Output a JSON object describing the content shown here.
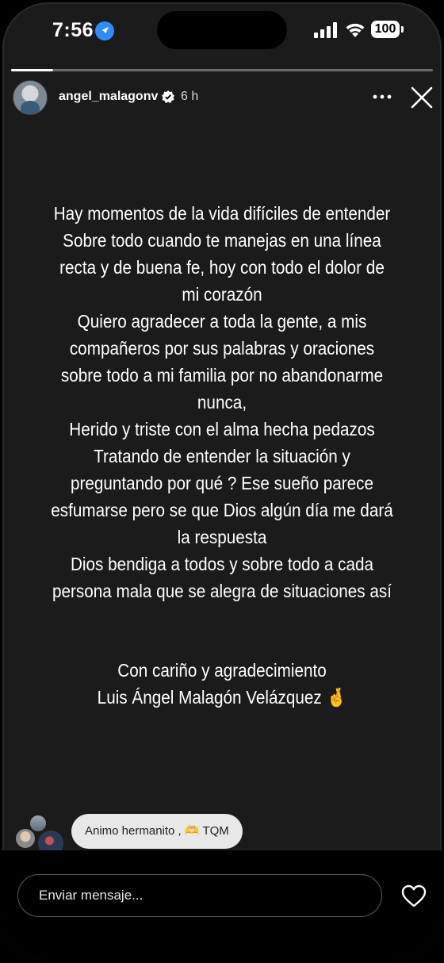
{
  "status_bar": {
    "time": "7:56",
    "battery": "100"
  },
  "story": {
    "progress_fraction": 0.1,
    "username": "angel_malagonv",
    "time_ago": "6 h",
    "text_lines": [
      "Hay momentos de la vida difíciles de entender",
      "Sobre todo cuando te manejas en una línea",
      "recta y de buena fe, hoy con todo el dolor de",
      "mi corazón",
      "Quiero agradecer a toda la gente, a mis",
      "compañeros por sus palabras y oraciones",
      "sobre todo a mi familia por no abandonarme",
      "nunca,",
      "Herido y triste con el alma hecha pedazos",
      "Tratando de entender la situación y",
      "preguntando por qué ? Ese sueño parece",
      "esfumarse pero se que Dios algún día me dará",
      "la respuesta",
      "Dios bendiga a todos y sobre todo a cada",
      "persona mala que se alegra de situaciones así"
    ],
    "signoff_line1": "Con cariño y agradecimiento",
    "signoff_line2": "Luis Ángel Malagón Velázquez 🤞"
  },
  "reply": {
    "text": "Animo hermanito , 🫶 TQM"
  },
  "message_bar": {
    "placeholder": "Enviar mensaje..."
  },
  "colors": {
    "background": "#1b1b1b",
    "text": "#ffffff",
    "bubble": "#e8e8e8"
  }
}
